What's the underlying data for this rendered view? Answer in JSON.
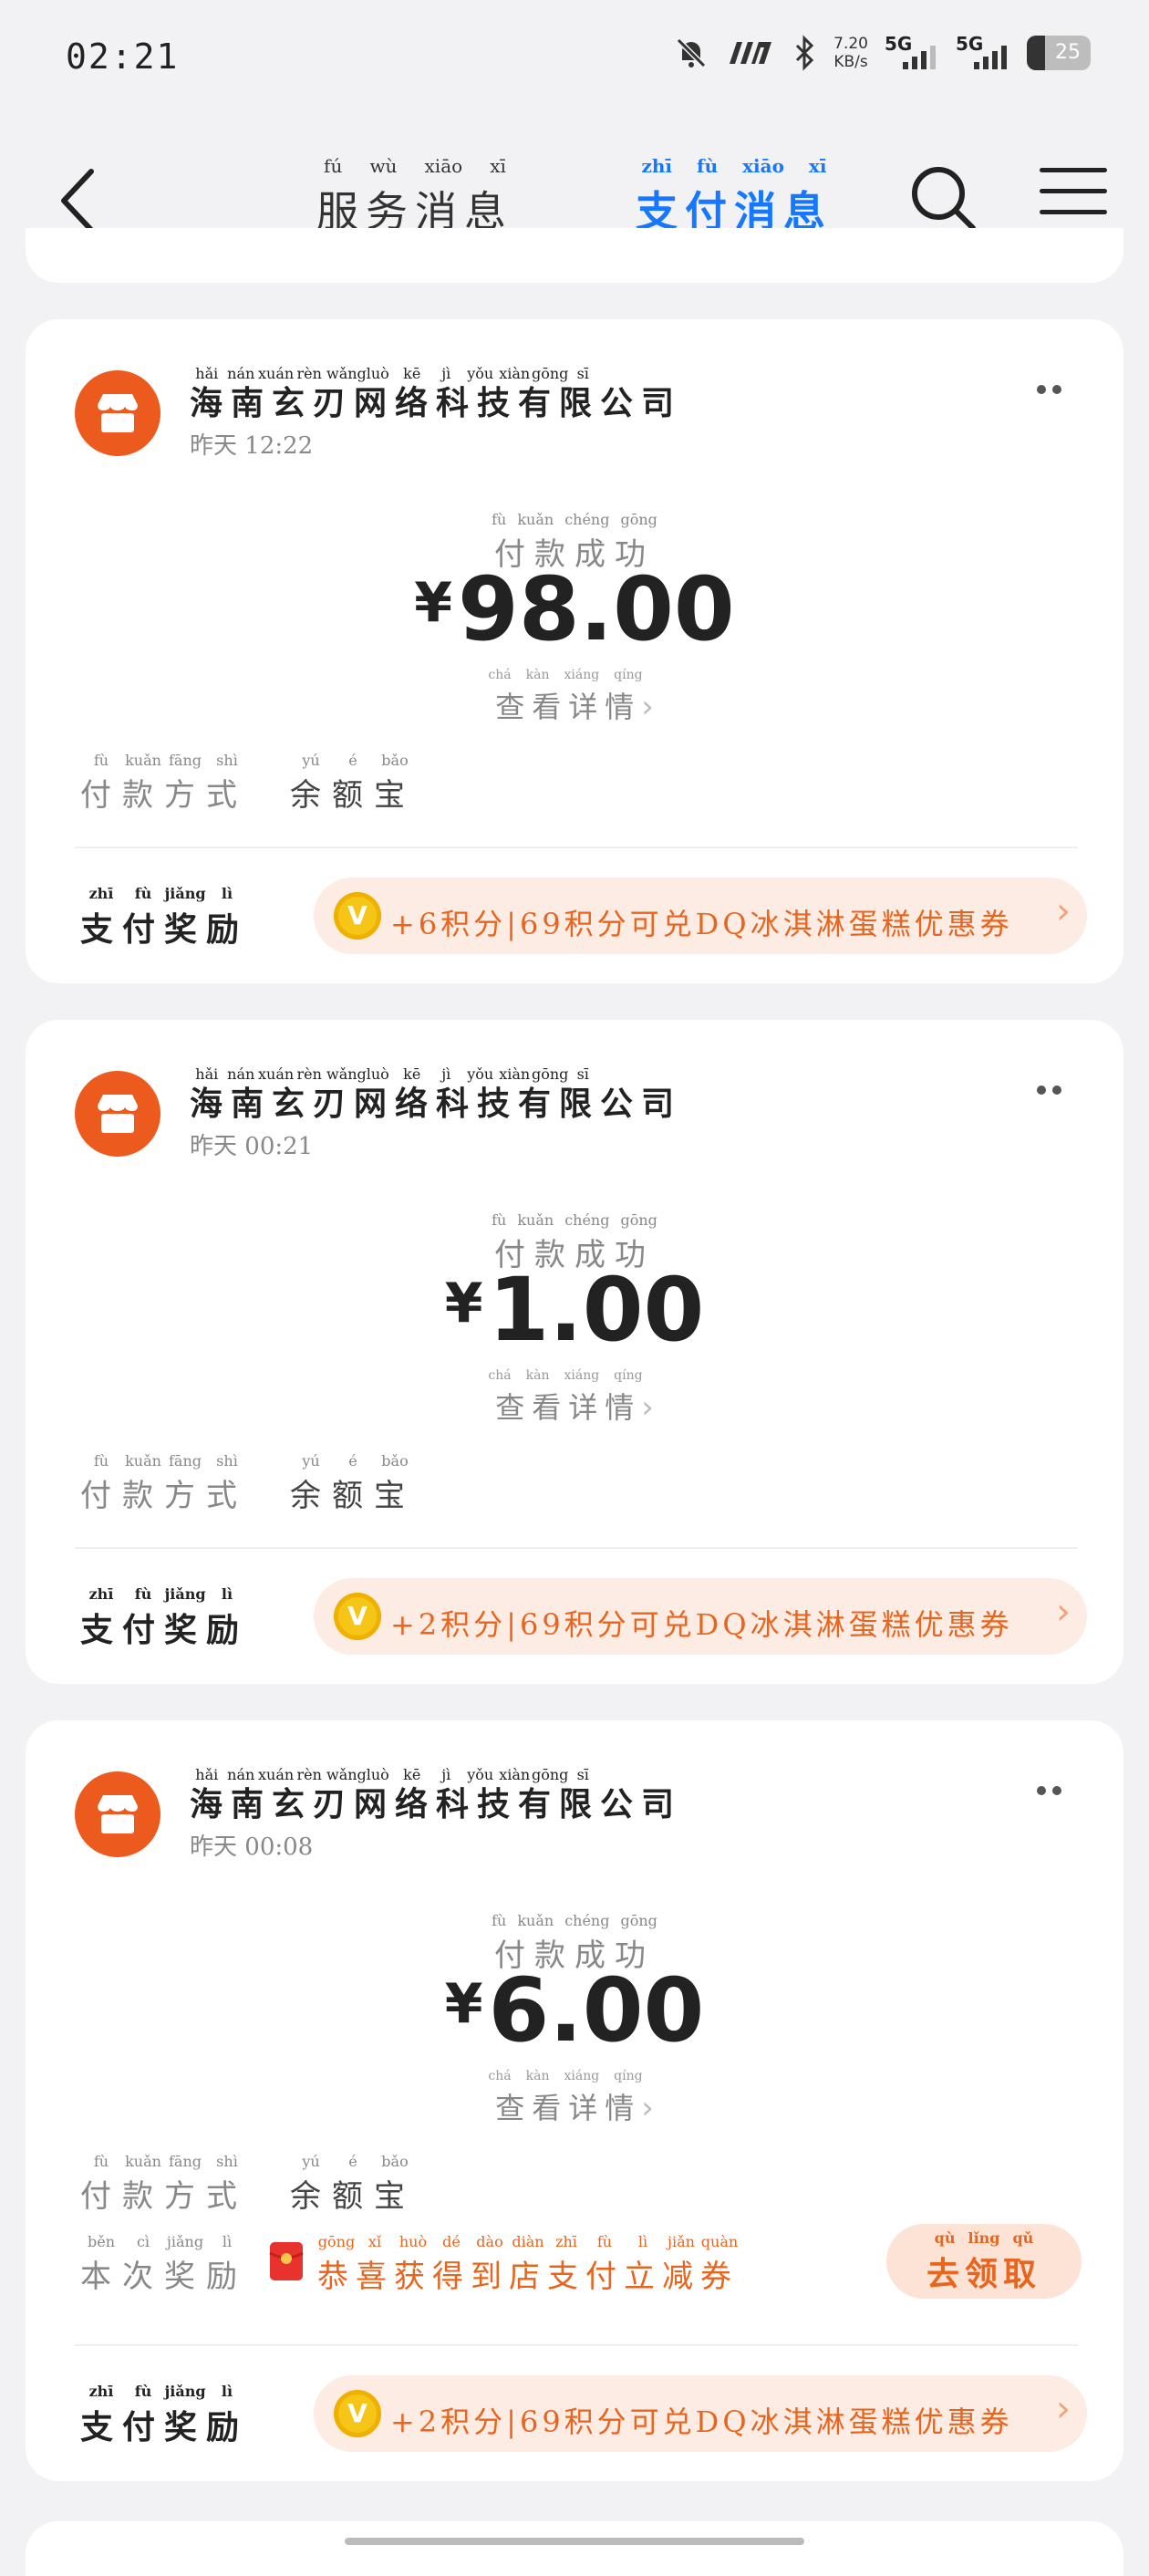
{
  "status_bar": {
    "time": "02:21",
    "net_speed": "7.20",
    "net_unit": "KB/s",
    "sim1": "5G",
    "sim2": "5G",
    "battery": "25"
  },
  "header": {
    "tabs": [
      {
        "label": "服务消息",
        "pinyin": [
          "fú",
          "wù",
          "xiāo",
          "xī"
        ]
      },
      {
        "label": "支付消息",
        "pinyin": [
          "zhī",
          "fù",
          "xiāo",
          "xī"
        ],
        "active": true
      }
    ]
  },
  "cards": [
    {
      "merchant": "海南玄刃网络科技有限公司",
      "merchant_pinyin": [
        "hǎi",
        "nán",
        "xuán",
        "rèn",
        "wǎng",
        "luò",
        "kē",
        "jì",
        "yǒu",
        "xiàn",
        "gōng",
        "sī"
      ],
      "date_label": "昨天",
      "time": "12:22",
      "status": "付款成功",
      "status_pinyin": [
        "fù",
        "kuǎn",
        "chéng",
        "gōng"
      ],
      "currency": "¥",
      "amount": "98.00",
      "detail_link": "查看详情",
      "detail_pinyin": [
        "chá",
        "kàn",
        "xiáng",
        "qíng"
      ],
      "method_label": "付款方式",
      "method_label_pinyin": [
        "fù",
        "kuǎn",
        "fāng",
        "shì"
      ],
      "method_value": "余额宝",
      "method_value_pinyin": [
        "yú",
        "é",
        "bǎo"
      ],
      "reward_label": "支付奖励",
      "reward_label_pinyin": [
        "zhī",
        "fù",
        "jiǎng",
        "lì"
      ],
      "reward_text": "+6积分|69积分可兑DQ冰淇淋蛋糕优惠券"
    },
    {
      "merchant": "海南玄刃网络科技有限公司",
      "merchant_pinyin": [
        "hǎi",
        "nán",
        "xuán",
        "rèn",
        "wǎng",
        "luò",
        "kē",
        "jì",
        "yǒu",
        "xiàn",
        "gōng",
        "sī"
      ],
      "date_label": "昨天",
      "time": "00:21",
      "status": "付款成功",
      "status_pinyin": [
        "fù",
        "kuǎn",
        "chéng",
        "gōng"
      ],
      "currency": "¥",
      "amount": "1.00",
      "detail_link": "查看详情",
      "detail_pinyin": [
        "chá",
        "kàn",
        "xiáng",
        "qíng"
      ],
      "method_label": "付款方式",
      "method_label_pinyin": [
        "fù",
        "kuǎn",
        "fāng",
        "shì"
      ],
      "method_value": "余额宝",
      "method_value_pinyin": [
        "yú",
        "é",
        "bǎo"
      ],
      "reward_label": "支付奖励",
      "reward_label_pinyin": [
        "zhī",
        "fù",
        "jiǎng",
        "lì"
      ],
      "reward_text": "+2积分|69积分可兑DQ冰淇淋蛋糕优惠券"
    },
    {
      "merchant": "海南玄刃网络科技有限公司",
      "merchant_pinyin": [
        "hǎi",
        "nán",
        "xuán",
        "rèn",
        "wǎng",
        "luò",
        "kē",
        "jì",
        "yǒu",
        "xiàn",
        "gōng",
        "sī"
      ],
      "date_label": "昨天",
      "time": "00:08",
      "status": "付款成功",
      "status_pinyin": [
        "fù",
        "kuǎn",
        "chéng",
        "gōng"
      ],
      "currency": "¥",
      "amount": "6.00",
      "detail_link": "查看详情",
      "detail_pinyin": [
        "chá",
        "kàn",
        "xiáng",
        "qíng"
      ],
      "method_label": "付款方式",
      "method_label_pinyin": [
        "fù",
        "kuǎn",
        "fāng",
        "shì"
      ],
      "method_value": "余额宝",
      "method_value_pinyin": [
        "yú",
        "é",
        "bǎo"
      ],
      "bonus_label": "本次奖励",
      "bonus_label_pinyin": [
        "běn",
        "cì",
        "jiǎng",
        "lì"
      ],
      "bonus_text": "恭喜获得到店支付立减券",
      "bonus_pinyin": [
        "gōng",
        "xǐ",
        "huò",
        "dé",
        "dào",
        "diàn",
        "zhī",
        "fù",
        "lì",
        "jiǎn",
        "quàn"
      ],
      "claim_button": "去领取",
      "claim_pinyin": [
        "qù",
        "lǐng",
        "qǔ"
      ],
      "reward_label": "支付奖励",
      "reward_label_pinyin": [
        "zhī",
        "fù",
        "jiǎng",
        "lì"
      ],
      "reward_text": "+2积分|69积分可兑DQ冰淇淋蛋糕优惠券"
    }
  ],
  "colors": {
    "accent": "#1677ff",
    "merchant_avatar": "#ec5a1e",
    "reward_orange": "#e8651e",
    "reward_bg": "#fdece4"
  }
}
